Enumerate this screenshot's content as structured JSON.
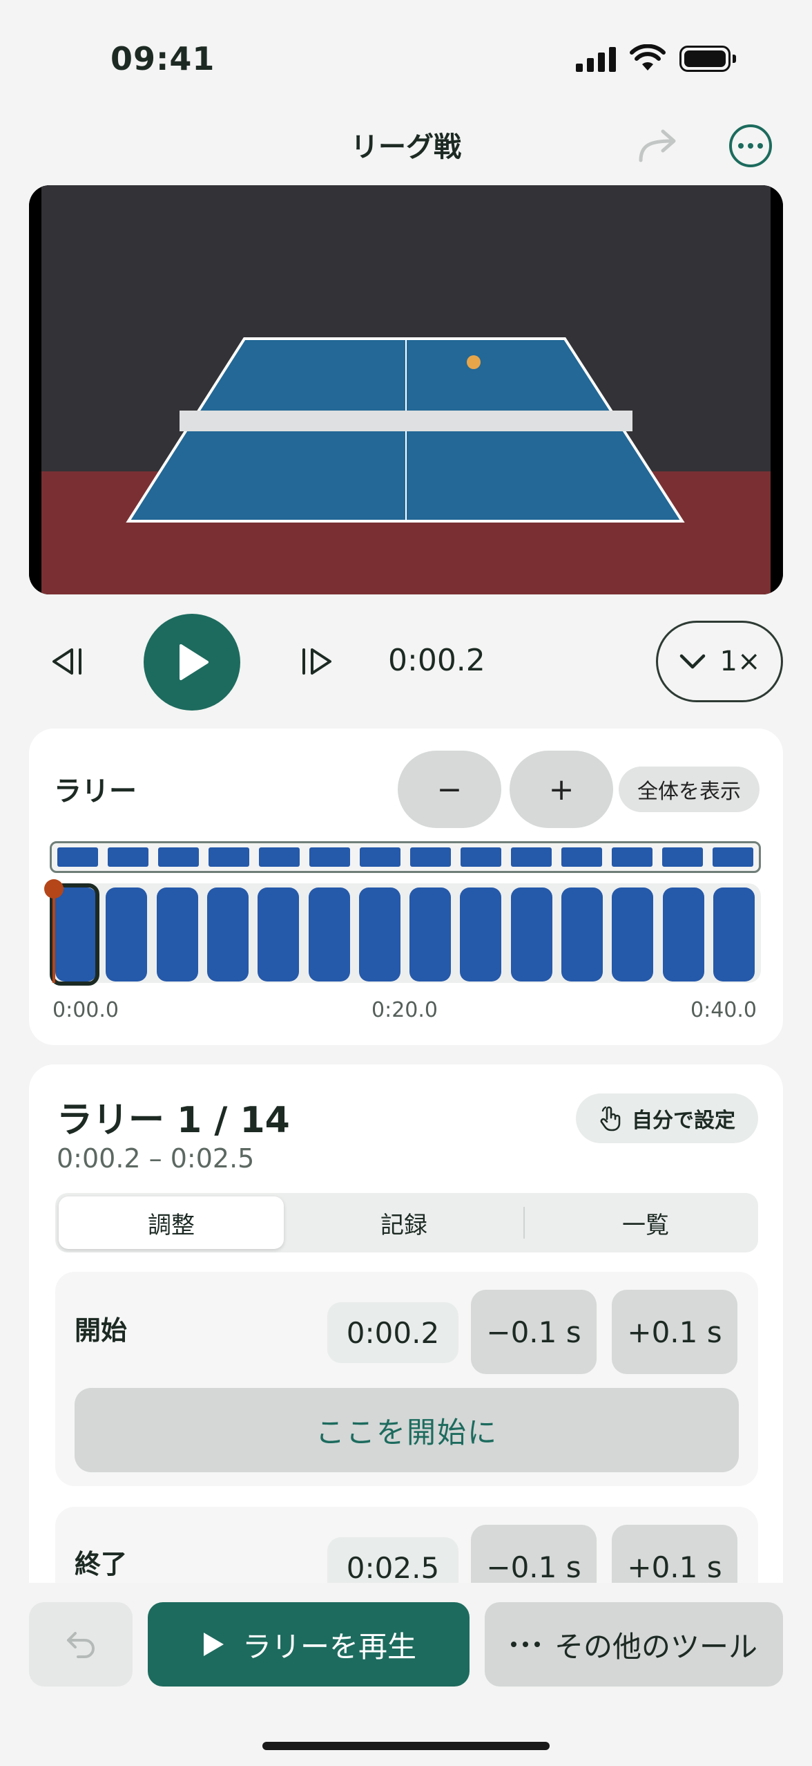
{
  "status_bar": {
    "time": "09:41"
  },
  "header": {
    "title": "リーグ戦",
    "share_icon": "share-forward-icon",
    "more_icon": "more-options-icon"
  },
  "player": {
    "current_time": "0:00.2",
    "speed_label": "1×"
  },
  "rally_timeline": {
    "label": "ラリー",
    "zoom_out_label": "−",
    "zoom_in_label": "+",
    "fit_label": "全体を表示",
    "rally_count": 14,
    "selected_index": 0,
    "tick_labels": [
      "0:00.0",
      "0:20.0",
      "0:40.0"
    ],
    "accent_color": "#2559aa",
    "playhead_color": "#b4461a"
  },
  "rally_detail": {
    "title": "ラリー 1 / 14",
    "range": "0:00.2 – 0:02.5",
    "manual_label": "自分で設定",
    "tabs": [
      "調整",
      "記録",
      "一覧"
    ],
    "active_tab": "調整",
    "start": {
      "label": "開始",
      "time": "0:00.2",
      "minus_label": "−0.1 s",
      "plus_label": "+0.1 s",
      "set_here_label": "ここを開始に"
    },
    "end": {
      "label": "終了",
      "time": "0:02.5",
      "minus_label": "−0.1 s",
      "plus_label": "+0.1 s"
    }
  },
  "toolbar": {
    "play_rally_label": "ラリーを再生",
    "more_tools_label": "その他のツール"
  },
  "colors": {
    "brand": "#1d6b5e",
    "table": "#236896",
    "floor": "#7a3033",
    "wall": "#333236"
  }
}
